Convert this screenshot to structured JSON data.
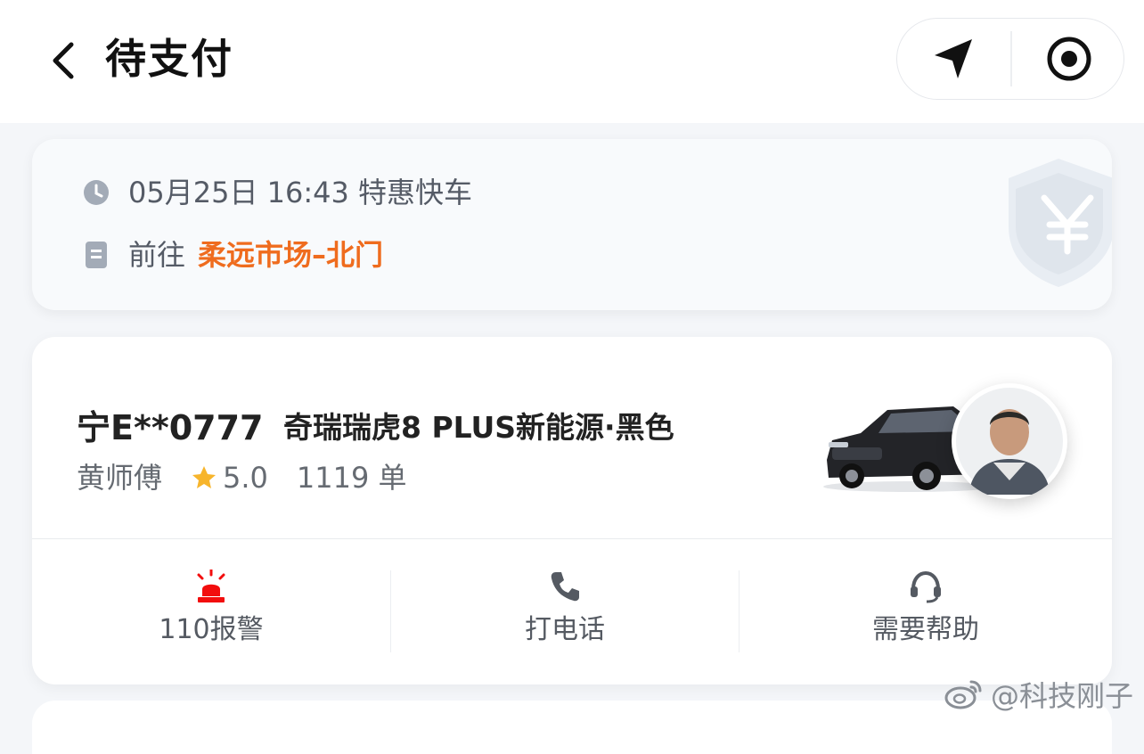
{
  "header": {
    "title": "待支付",
    "back_icon": "chevron-left-icon",
    "nav_icon": "navigation-arrow-icon",
    "target_icon": "target-icon"
  },
  "trip": {
    "time": "05月25日 16:43 特惠快车",
    "to_label": "前往",
    "destination": "柔远市场–北门",
    "destination_color": "#ef6c1e",
    "clock_icon": "clock-icon",
    "doc_icon": "document-icon"
  },
  "driver": {
    "plate": "宁E**0777",
    "car": "奇瑞瑞虎8 PLUS新能源·黑色",
    "name": "黄师傅",
    "rating": "5.0",
    "orders": "1119 单"
  },
  "actions": [
    {
      "label": "110报警",
      "icon": "alarm-siren-icon",
      "color": "#f20d0d"
    },
    {
      "label": "打电话",
      "icon": "phone-icon",
      "color": "#555a62"
    },
    {
      "label": "需要帮助",
      "icon": "headset-icon",
      "color": "#555a62"
    }
  ],
  "watermark": {
    "text": "@科技刚子",
    "icon": "weibo-logo-icon"
  }
}
